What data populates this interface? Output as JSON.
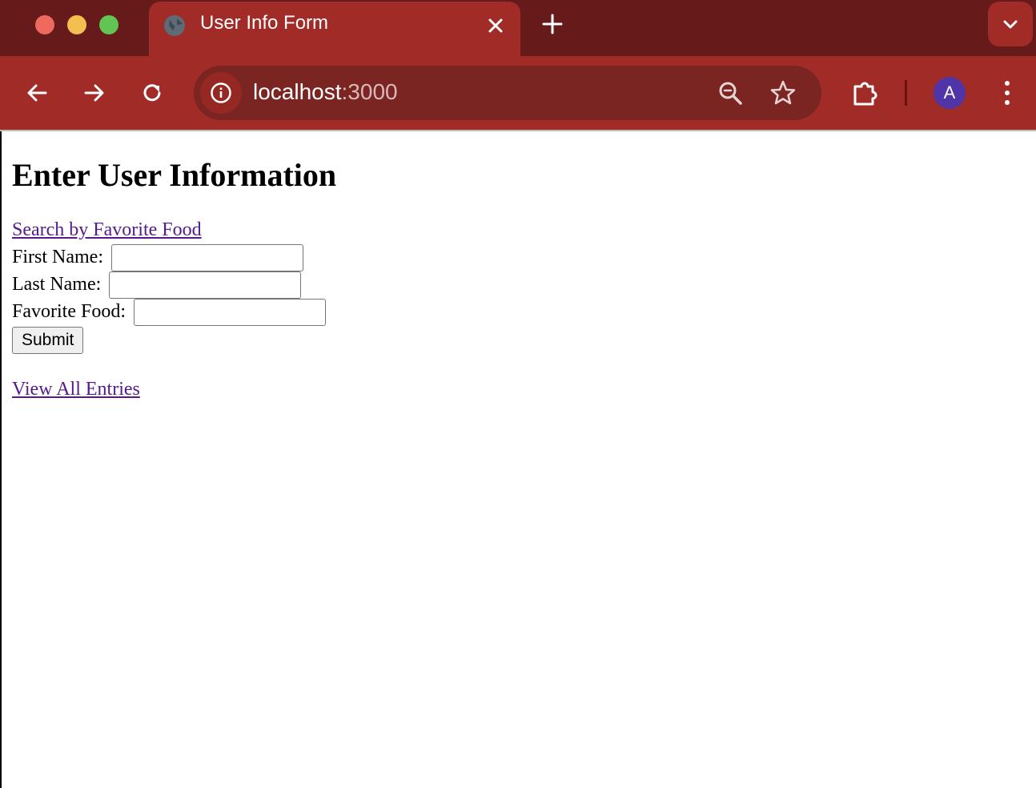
{
  "browser": {
    "tab_title": "User Info Form",
    "url_host": "localhost",
    "url_port": ":3000",
    "profile_initial": "A",
    "theme_color": "#a02b27",
    "frame_color": "#661a1a"
  },
  "page": {
    "heading": "Enter User Information",
    "search_link": "Search by Favorite Food",
    "form": {
      "first_name_label": "First Name:",
      "first_name_value": "",
      "last_name_label": "Last Name:",
      "last_name_value": "",
      "favorite_food_label": "Favorite Food:",
      "favorite_food_value": "",
      "submit_label": "Submit"
    },
    "view_all_link": "View All Entries",
    "link_color": "#551a8b"
  },
  "icons": [
    "globe-icon",
    "close-icon",
    "plus-icon",
    "chevron-down-icon",
    "back-arrow-icon",
    "forward-arrow-icon",
    "reload-icon",
    "info-icon",
    "zoom-out-icon",
    "star-icon",
    "extensions-icon",
    "more-vert-icon"
  ]
}
